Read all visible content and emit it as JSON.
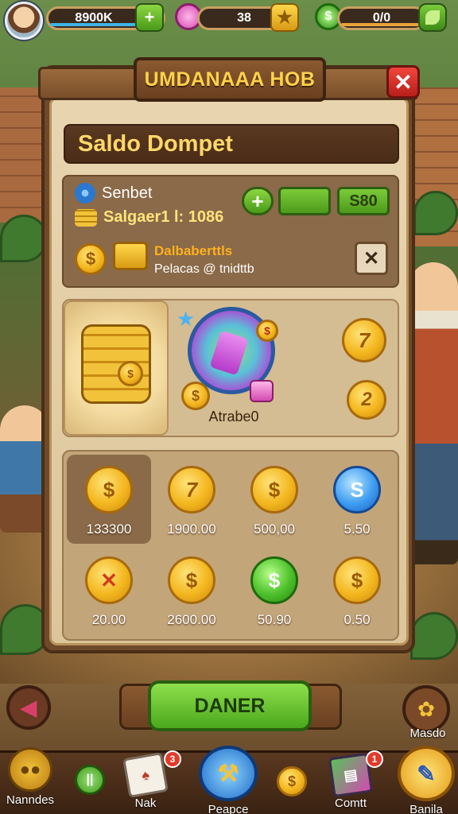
{
  "top_bar": {
    "gold_value": "8900K",
    "gems_value": "38",
    "cash_value": "0/0",
    "plus_symbol": "+",
    "star_symbol": "★",
    "dollar_symbol": "$"
  },
  "dialog": {
    "title": "UMDANAAA HOB",
    "close_symbol": "✕",
    "header": "Saldo Dompet"
  },
  "wallet_info": {
    "label": "Senbet",
    "balance": "Salgaer1 l: 1086",
    "plus_symbol": "+",
    "amount": "S80",
    "promo_title": "Dalbaberttls",
    "promo_subtitle": "Pelacas @ tnidttb",
    "dismiss_symbol": "✕"
  },
  "feature": {
    "badge_label": "Atrabe0",
    "side_coin_1": "7",
    "side_coin_2": "2"
  },
  "coin_grid": [
    {
      "symbol": "$",
      "value": "133300",
      "style": "gold"
    },
    {
      "symbol": "7",
      "value": "1900.00",
      "style": "gold"
    },
    {
      "symbol": "$",
      "value": "500,00",
      "style": "gold"
    },
    {
      "symbol": "S",
      "value": "5.50",
      "style": "blue"
    },
    {
      "symbol": "✕",
      "value": "20.00",
      "style": "cross"
    },
    {
      "symbol": "$",
      "value": "2600.00",
      "style": "gold"
    },
    {
      "symbol": "$",
      "value": "50.90",
      "style": "green"
    },
    {
      "symbol": "$",
      "value": "0.50",
      "style": "gold"
    }
  ],
  "actions": {
    "primary_button": "DANER",
    "mascot_label": "Masdo"
  },
  "bottom_nav": [
    {
      "label": "Nanndes",
      "badge": ""
    },
    {
      "label": "",
      "badge": ""
    },
    {
      "label": "Nak",
      "badge": "3"
    },
    {
      "label": "Peapce",
      "badge": ""
    },
    {
      "label": "",
      "badge": ""
    },
    {
      "label": "Comtt",
      "badge": "1"
    },
    {
      "label": "Banila",
      "badge": ""
    }
  ],
  "colors": {
    "gold": "#f3b61e",
    "green_accent": "#4aa81c",
    "wood": "#6f4a2a",
    "close_red": "#d0261e"
  }
}
